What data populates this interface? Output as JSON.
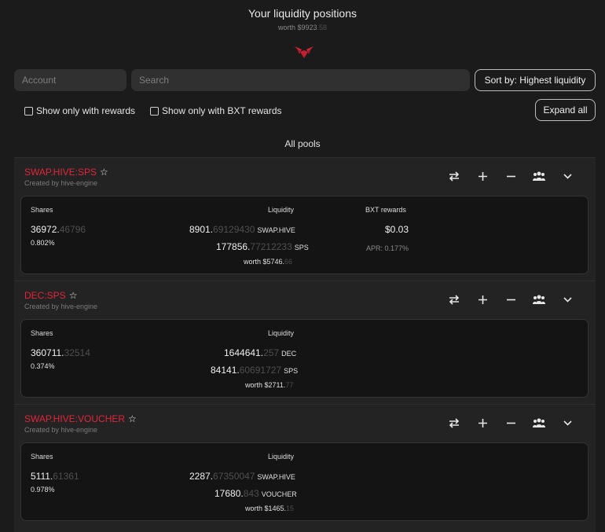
{
  "header": {
    "title": "Your liquidity positions",
    "worth_prefix": "worth $9923",
    "worth_dim": ".58"
  },
  "filters": {
    "account_placeholder": "Account",
    "search_placeholder": "Search",
    "sort_label": "Sort by: Highest liquidity",
    "show_rewards": "Show only with rewards",
    "show_bxt": "Show only with BXT rewards",
    "expand_all": "Expand all",
    "all_pools": "All pools"
  },
  "colors": {
    "accent": "#e3243b",
    "background": "#1b1b1b"
  },
  "pools": [
    {
      "name": "SWAP.HIVE:SPS",
      "created_by": "Created by hive-engine",
      "shares_label": "Shares",
      "shares_int": "36972.",
      "shares_dec": "46796",
      "shares_pct": "0.802%",
      "liquidity_label": "Liquidity",
      "liq1_int": "8901.",
      "liq1_dec": "69129430",
      "liq1_token": "SWAP.HIVE",
      "liq2_int": "177856.",
      "liq2_dec": "77212233",
      "liq2_token": "SPS",
      "worth_int": "worth $5746.",
      "worth_dec": "66",
      "rewards_label": "BXT rewards",
      "rewards_value": "$0.03",
      "apr": "APR: 0.177%"
    },
    {
      "name": "DEC:SPS",
      "created_by": "Created by hive-engine",
      "shares_label": "Shares",
      "shares_int": "360711.",
      "shares_dec": "32514",
      "shares_pct": "0.374%",
      "liquidity_label": "Liquidity",
      "liq1_int": "1644641.",
      "liq1_dec": "257",
      "liq1_token": "DEC",
      "liq2_int": "84141.",
      "liq2_dec": "60691727",
      "liq2_token": "SPS",
      "worth_int": "worth $2711.",
      "worth_dec": "77"
    },
    {
      "name": "SWAP.HIVE:VOUCHER",
      "created_by": "Created by hive-engine",
      "shares_label": "Shares",
      "shares_int": "5111.",
      "shares_dec": "61361",
      "shares_pct": "0.978%",
      "liquidity_label": "Liquidity",
      "liq1_int": "2287.",
      "liq1_dec": "67350047",
      "liq1_token": "SWAP.HIVE",
      "liq2_int": "17680.",
      "liq2_dec": "843",
      "liq2_token": "VOUCHER",
      "worth_int": "worth $1465.",
      "worth_dec": "15"
    }
  ],
  "icons": [
    "swap-icon",
    "plus-icon",
    "minus-icon",
    "users-icon",
    "chevron-down-icon",
    "star-icon",
    "hive-logo-icon"
  ]
}
